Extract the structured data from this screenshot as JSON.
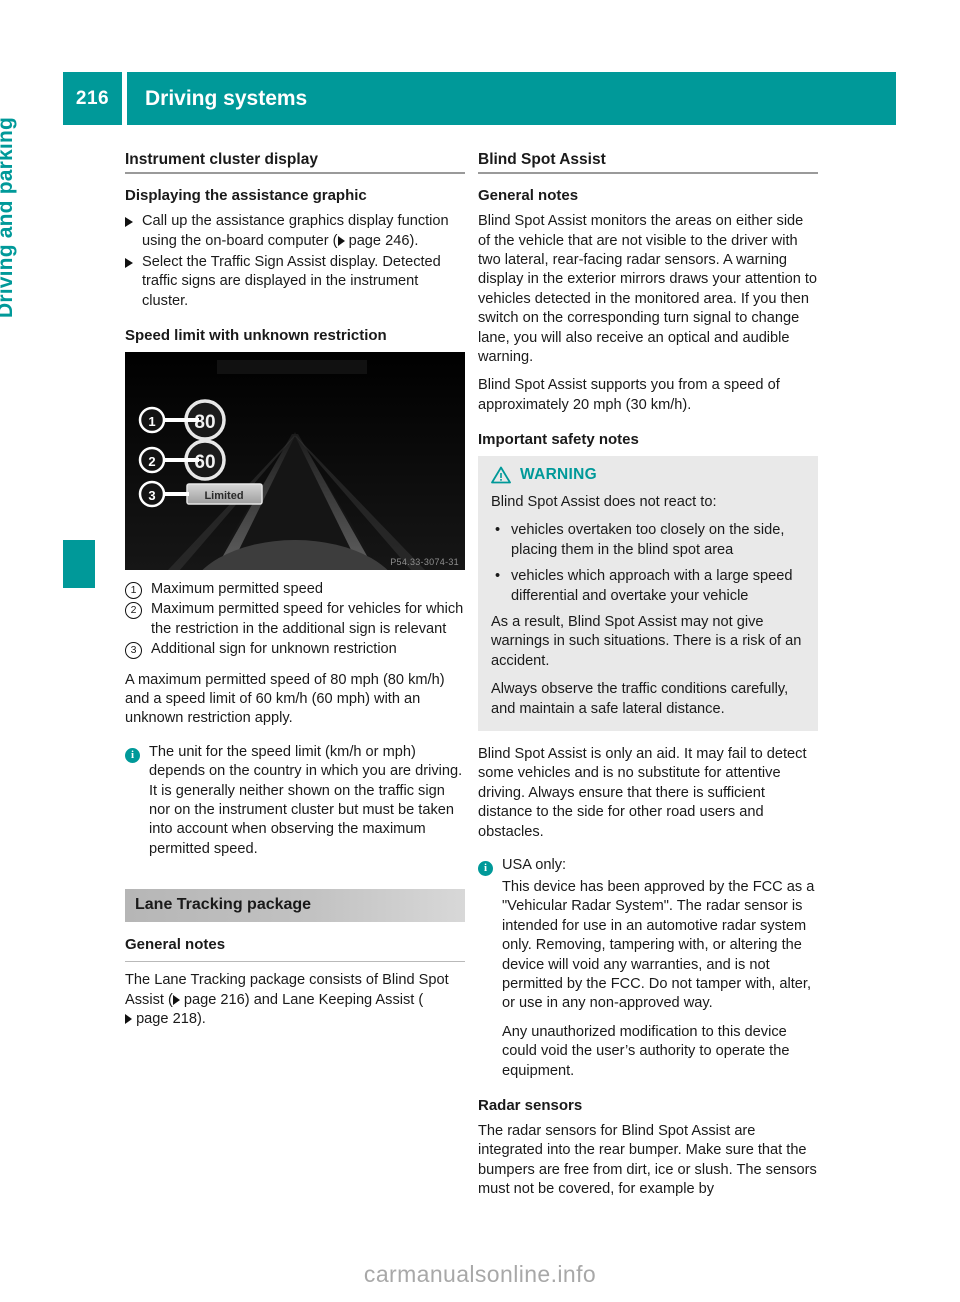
{
  "header": {
    "page_number": "216",
    "title": "Driving systems"
  },
  "side_tab": {
    "label": "Driving and parking"
  },
  "left_column": {
    "section_title": "Instrument cluster display",
    "sub1_title": "Displaying the assistance graphic",
    "steps": [
      {
        "text_before": "Call up the assistance graphics display function using the on-board computer (",
        "pageref": "page 246",
        "text_after": ")."
      },
      {
        "text_before": "Select the Traffic Sign Assist display. Detected traffic signs are displayed in the instrument cluster.",
        "pageref": "",
        "text_after": ""
      }
    ],
    "sub2_title": "Speed limit with unknown restriction",
    "figure": {
      "caption_code": "P54.33-3074-31",
      "sign1_value": "80",
      "sign2_value": "60",
      "sign3_value": "Limited",
      "callout1": "1",
      "callout2": "2",
      "callout3": "3"
    },
    "legend": [
      {
        "num": "1",
        "text": "Maximum permitted speed"
      },
      {
        "num": "2",
        "text": "Maximum permitted speed for vehicles for which the restriction in the additional sign is relevant"
      },
      {
        "num": "3",
        "text": "Additional sign for unknown restriction"
      }
    ],
    "body1": "A maximum permitted speed of 80 mph (80 km/h) and a speed limit of 60 km/h (60 mph) with an unknown restriction apply.",
    "info_note": "The unit for the speed limit (km/h or mph) depends on the country in which you are driving. It is generally neither shown on the traffic sign nor on the instrument cluster but must be taken into account when observing the maximum permitted speed.",
    "band_title": "Lane Tracking package",
    "sub3_title": "General notes",
    "body2_a": "The Lane Tracking package consists of Blind Spot Assist (",
    "body2_ref1": "page 216",
    "body2_b": ") and Lane Keeping Assist (",
    "body2_ref2": "page 218",
    "body2_c": ")."
  },
  "right_column": {
    "section_title": "Blind Spot Assist",
    "sub1_title": "General notes",
    "body1": "Blind Spot Assist monitors the areas on either side of the vehicle that are not visible to the driver with two lateral, rear-facing radar sensors. A warning display in the exterior mirrors draws your attention to vehicles detected in the monitored area. If you then switch on the corresponding turn signal to change lane, you will also receive an optical and audible warning.",
    "body2": "Blind Spot Assist supports you from a speed of approximately 20 mph (30 km/h).",
    "sub2_title": "Important safety notes",
    "warning": {
      "label": "WARNING",
      "intro": "Blind Spot Assist does not react to:",
      "bullets": [
        "vehicles overtaken too closely on the side, placing them in the blind spot area",
        "vehicles which approach with a large speed differential and overtake your vehicle"
      ],
      "para1": "As a result, Blind Spot Assist may not give warnings in such situations. There is a risk of an accident.",
      "para2": "Always observe the traffic conditions carefully, and maintain a safe lateral distance."
    },
    "body3": "Blind Spot Assist is only an aid. It may fail to detect some vehicles and is no substitute for attentive driving. Always ensure that there is sufficient distance to the side for other road users and obstacles.",
    "usa_note": {
      "title": "USA only:",
      "para1": "This device has been approved by the FCC as a \"Vehicular Radar System\". The radar sensor is intended for use in an automotive radar system only. Removing, tampering with, or altering the device will void any warranties, and is not permitted by the FCC. Do not tamper with, alter, or use in any non-approved way.",
      "para2": "Any unauthorized modification to this device could void the user’s authority to operate the equipment."
    },
    "sub3_title": "Radar sensors",
    "body4": "The radar sensors for Blind Spot Assist are integrated into the rear bumper. Make sure that the bumpers are free from dirt, ice or slush. The sensors must not be covered, for example by"
  },
  "footer": {
    "watermark": "carmanualsonline.info"
  },
  "colors": {
    "accent": "#009999",
    "warning_bg": "#e9e9e9",
    "band": "#c2c2c2"
  }
}
